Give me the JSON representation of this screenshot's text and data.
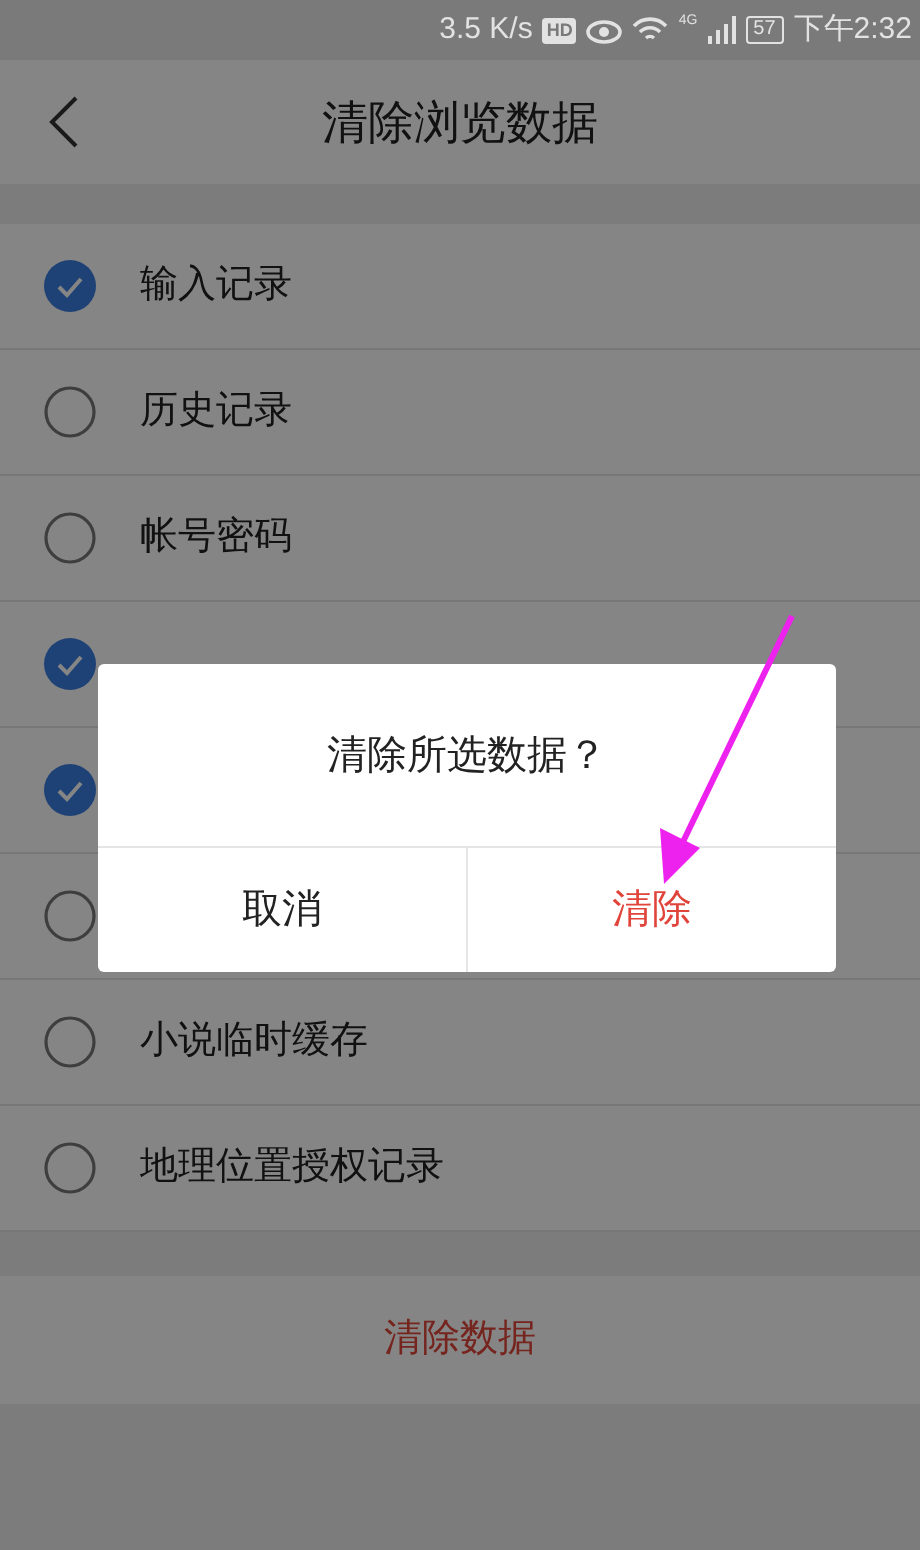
{
  "status_bar": {
    "speed": "3.5 K/s",
    "hd_badge": "HD",
    "network": "4G",
    "battery": "57",
    "time": "下午2:32"
  },
  "header": {
    "title": "清除浏览数据"
  },
  "items": [
    {
      "label": "输入记录",
      "checked": true
    },
    {
      "label": "历史记录",
      "checked": false
    },
    {
      "label": "帐号密码",
      "checked": false
    },
    {
      "checked": true
    },
    {
      "checked": true
    },
    {
      "checked": false
    },
    {
      "label": "小说临时缓存",
      "checked": false
    },
    {
      "label": "地理位置授权记录",
      "checked": false
    }
  ],
  "clear_button": "清除数据",
  "dialog": {
    "message": "清除所选数据？",
    "buttons": [
      {
        "label": "取消",
        "kind": "cancel"
      },
      {
        "label": "清除",
        "kind": "confirm"
      }
    ]
  }
}
